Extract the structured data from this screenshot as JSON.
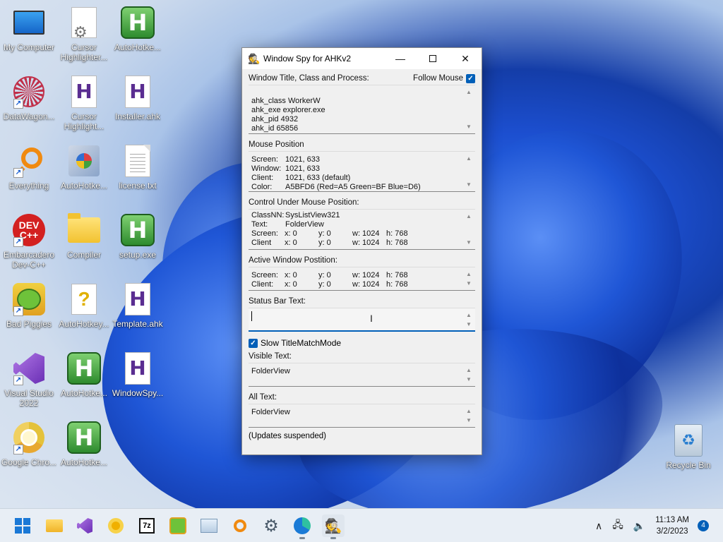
{
  "desktop": {
    "icons": [
      {
        "label": "My Computer",
        "icon": "monitor-icon"
      },
      {
        "label": "Cursor Highlighter...",
        "icon": "gear-document-icon"
      },
      {
        "label": "AutoHotke...",
        "icon": "autohotkey-icon"
      },
      {
        "label": "DataWagon...",
        "icon": "flower-icon"
      },
      {
        "label": "Cursor Highlight...",
        "icon": "ahk-script-icon"
      },
      {
        "label": "Installer.ahk",
        "icon": "ahk-script-icon"
      },
      {
        "label": "Everything",
        "icon": "magnifier-icon"
      },
      {
        "label": "AutoHotke...",
        "icon": "setup-icon"
      },
      {
        "label": "license.txt",
        "icon": "text-document-icon"
      },
      {
        "label": "Embarcadero Dev-C++",
        "icon": "devcpp-icon"
      },
      {
        "label": "Compiler",
        "icon": "folder-icon"
      },
      {
        "label": "setup.exe",
        "icon": "autohotkey-icon"
      },
      {
        "label": "Bad Piggies",
        "icon": "bad-piggies-icon"
      },
      {
        "label": "AutoHotkey...",
        "icon": "help-document-icon"
      },
      {
        "label": "Template.ahk",
        "icon": "ahk-script-icon"
      },
      {
        "label": "Visual Studio 2022",
        "icon": "visual-studio-icon"
      },
      {
        "label": "AutoHotke...",
        "icon": "autohotkey-icon"
      },
      {
        "label": "WindowSpy...",
        "icon": "ahk-script-icon"
      },
      {
        "label": "Google Chro...",
        "icon": "chrome-icon"
      },
      {
        "label": "AutoHotke...",
        "icon": "autohotkey-icon"
      }
    ],
    "recycle_bin": "Recycle Bin"
  },
  "window": {
    "title": "Window Spy for AHKv2",
    "minimize": "—",
    "close": "✕",
    "title_section": {
      "label": "Window Title, Class and Process:",
      "follow_mouse": "Follow Mouse",
      "lines": [
        "ahk_class WorkerW",
        "ahk_exe explorer.exe",
        "ahk_pid 4932",
        "ahk_id 65856"
      ]
    },
    "mouse_section": {
      "label": "Mouse Position",
      "rows": [
        {
          "k": "Screen:",
          "v": "1021, 633"
        },
        {
          "k": "Window:",
          "v": "1021, 633"
        },
        {
          "k": "Client:",
          "v": "1021, 633 (default)"
        },
        {
          "k": "Color:",
          "v": "A5BFD6 (Red=A5 Green=BF Blue=D6)"
        }
      ]
    },
    "control_section": {
      "label": "Control Under Mouse Position:",
      "classnn_k": "ClassNN:",
      "classnn_v": "SysListView321",
      "text_k": "Text:",
      "text_v": "FolderView",
      "rows": [
        {
          "name": "Screen:",
          "x": "x: 0",
          "y": "y: 0",
          "w": "w: 1024",
          "h": "h: 768"
        },
        {
          "name": "Client",
          "x": "x: 0",
          "y": "y: 0",
          "w": "w: 1024",
          "h": "h: 768"
        }
      ]
    },
    "active_section": {
      "label": "Active Window Postition:",
      "rows": [
        {
          "name": "Screen:",
          "x": "x: 0",
          "y": "y: 0",
          "w": "w: 1024",
          "h": "h: 768"
        },
        {
          "name": "Client:",
          "x": "x: 0",
          "y": "y: 0",
          "w": "w: 1024",
          "h": "h: 768"
        }
      ]
    },
    "status_section": {
      "label": "Status Bar Text:",
      "value": ""
    },
    "slow_mode": "Slow TitleMatchMode",
    "visible_section": {
      "label": "Visible Text:",
      "value": "FolderView"
    },
    "all_section": {
      "label": "All Text:",
      "value": "FolderView"
    },
    "footer": "(Updates suspended)"
  },
  "taskbar": {
    "apps": [
      "start-icon",
      "file-explorer-icon",
      "visual-studio-icon",
      "chrome-canary-icon",
      "7zip-icon",
      "bad-piggies-icon",
      "datawagon-icon",
      "everything-icon",
      "settings-icon",
      "edge-icon",
      "window-spy-icon"
    ],
    "seven_zip_label": "7z",
    "time": "11:13 AM",
    "date": "3/2/2023",
    "notifications": "4",
    "tray_chevron": "∧"
  }
}
